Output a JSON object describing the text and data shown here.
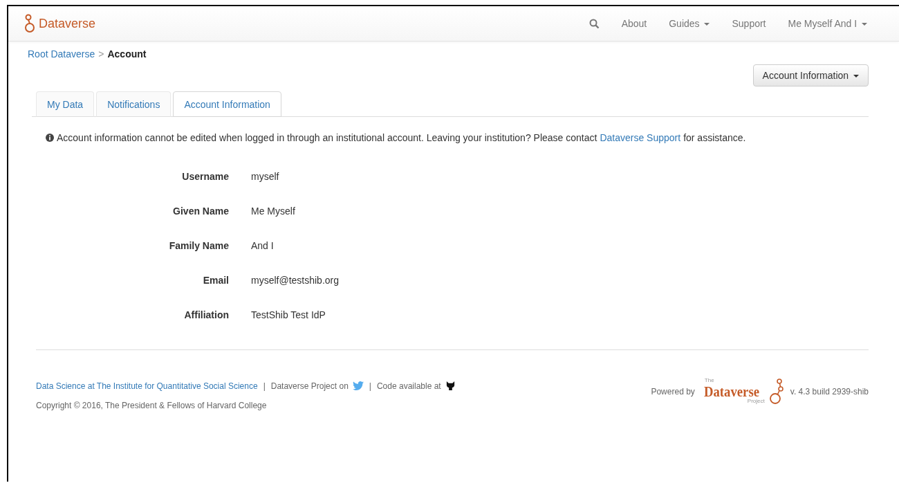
{
  "navbar": {
    "brand": "Dataverse",
    "items": [
      {
        "kind": "search"
      },
      {
        "kind": "link",
        "label": "About"
      },
      {
        "kind": "dropdown",
        "label": "Guides"
      },
      {
        "kind": "link",
        "label": "Support"
      },
      {
        "kind": "dropdown",
        "label": "Me Myself And I"
      }
    ]
  },
  "breadcrumb": {
    "parent": "Root Dataverse",
    "separator": ">",
    "current": "Account"
  },
  "account_button": "Account Information",
  "tabs": [
    {
      "label": "My Data",
      "selected": false
    },
    {
      "label": "Notifications",
      "selected": false
    },
    {
      "label": "Account Information",
      "selected": true
    }
  ],
  "notice": {
    "text": "Account information cannot be edited when logged in through an institutional account. Leaving your institution? Please contact",
    "link": "Dataverse Support",
    "after": "for assistance."
  },
  "fields": [
    {
      "label": "Username",
      "value": "myself"
    },
    {
      "label": "Given Name",
      "value": "Me Myself"
    },
    {
      "label": "Family Name",
      "value": "And I"
    },
    {
      "label": "Email",
      "value": "myself@testshib.org"
    },
    {
      "label": "Affiliation",
      "value": "TestShib Test IdP"
    }
  ],
  "footer": {
    "institute_link": "Data Science at The Institute for Quantitative Social Science",
    "separator": "|",
    "project_text": "Dataverse Project on",
    "code_text": "Code available at",
    "copyright": "Copyright © 2016, The President & Fellows of Harvard College",
    "powered_by": "Powered by",
    "logo_the": "The",
    "logo_name": "Dataverse",
    "logo_project": "Project",
    "version": "v. 4.3 build 2939-shib"
  }
}
